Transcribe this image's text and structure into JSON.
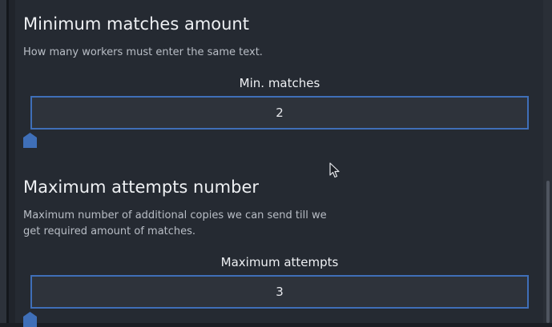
{
  "sections": [
    {
      "title": "Minimum matches amount",
      "description": "How many workers must enter the same text.",
      "field_label": "Min. matches",
      "value": "2"
    },
    {
      "title": "Maximum attempts number",
      "description": "Maximum number of additional copies we can send till we get required amount of matches.",
      "field_label": "Maximum attempts",
      "value": "3"
    }
  ],
  "colors": {
    "accent": "#3f6fb8",
    "background": "#252a32",
    "field_background": "#2e333b"
  },
  "icons": {
    "slider_handle": "pentagon-slider-handle-icon",
    "cursor": "mouse-pointer-icon"
  }
}
